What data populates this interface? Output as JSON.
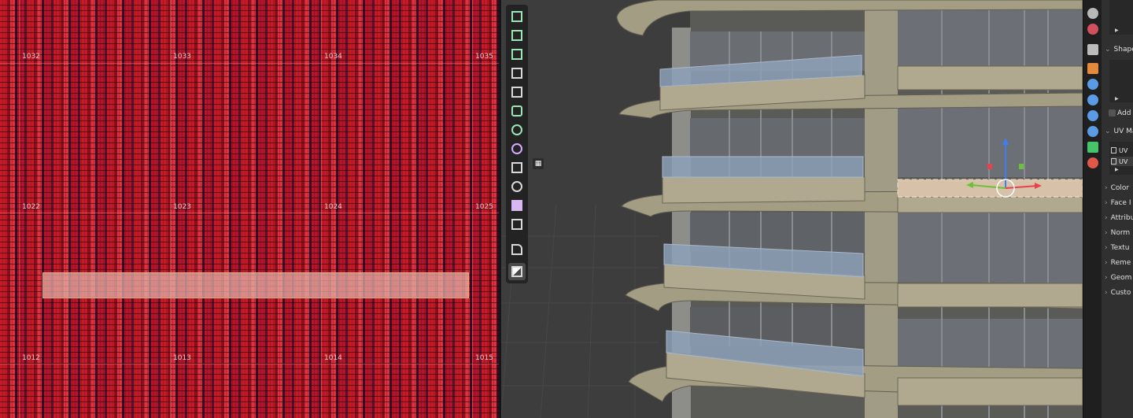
{
  "uv_editor": {
    "tile_labels": {
      "t1032": "1032",
      "t1033": "1033",
      "t1034": "1034",
      "t1035": "1035",
      "t1022": "1022",
      "t1023": "1023",
      "t1024": "1024",
      "t1025": "1025",
      "t1012": "1012",
      "t1013": "1013",
      "t1014": "1014",
      "t1015": "1015"
    }
  },
  "viewport": {
    "toolbar": [
      {
        "name": "add-cube-icon"
      },
      {
        "name": "extrude-region-icon"
      },
      {
        "name": "extrude-manifold-icon"
      },
      {
        "name": "inset-faces-icon"
      },
      {
        "name": "bevel-icon"
      },
      {
        "name": "loop-cut-icon"
      },
      {
        "name": "knife-icon"
      },
      {
        "name": "poly-build-icon"
      },
      {
        "name": "spin-icon"
      },
      {
        "name": "move-icon"
      },
      {
        "name": "shrink-fatten-icon"
      },
      {
        "name": "shear-icon"
      },
      {
        "name": "rip-region-icon"
      },
      {
        "name": "annotate-icon"
      }
    ],
    "gizmo_colors": {
      "x": "#e8414b",
      "y": "#6ac13c",
      "z": "#3b7ff0"
    }
  },
  "properties": {
    "panels": {
      "shape_keys": "Shape",
      "add_rest": "Add R",
      "uv_maps": "UV Ma",
      "uv_item_1": "UV",
      "uv_item_2": "UV",
      "color_attributes": "Color",
      "face_maps": "Face I",
      "attributes": "Attribu",
      "normals": "Norm",
      "texture_space": "Textu",
      "remesh": "Reme",
      "geometry_data": "Geom",
      "custom_properties": "Custo"
    }
  }
}
